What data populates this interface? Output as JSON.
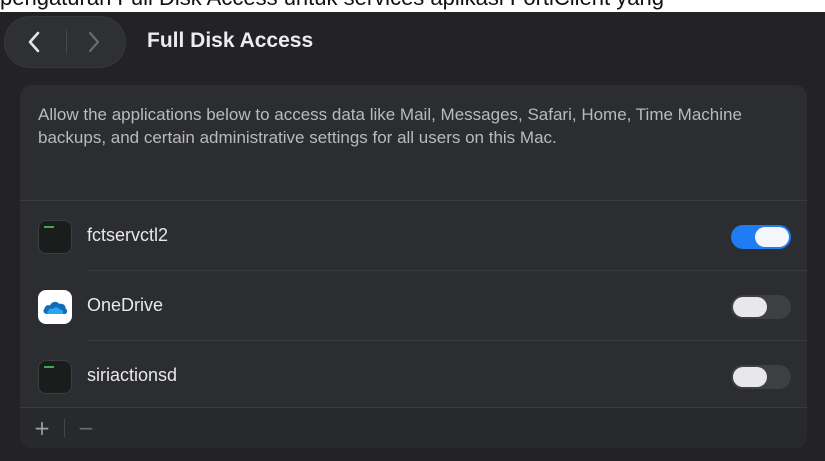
{
  "caption": "pengaturan Full Disk Access untuk services aplikasi FortiClient yang",
  "toolbar": {
    "title": "Full Disk Access",
    "back_icon": "chevron-left-icon",
    "forward_icon": "chevron-right-icon"
  },
  "panel": {
    "description": "Allow the applications below to access data like Mail, Messages, Safari, Home, Time Machine backups, and certain administrative settings for all users on this Mac."
  },
  "apps": [
    {
      "name": "fctservctl2",
      "icon": "terminal-icon",
      "enabled": true
    },
    {
      "name": "OneDrive",
      "icon": "onedrive-icon",
      "enabled": false
    },
    {
      "name": "siriactionsd",
      "icon": "terminal-icon",
      "enabled": false
    }
  ],
  "footer": {
    "add_label": "+",
    "remove_label": "−"
  },
  "colors": {
    "window_bg": "#232325",
    "panel_bg": "#2c2d30",
    "toggle_on": "#1f7cf5",
    "toggle_off": "#3e3f43",
    "onedrive_blue": "#0f6cbd"
  }
}
